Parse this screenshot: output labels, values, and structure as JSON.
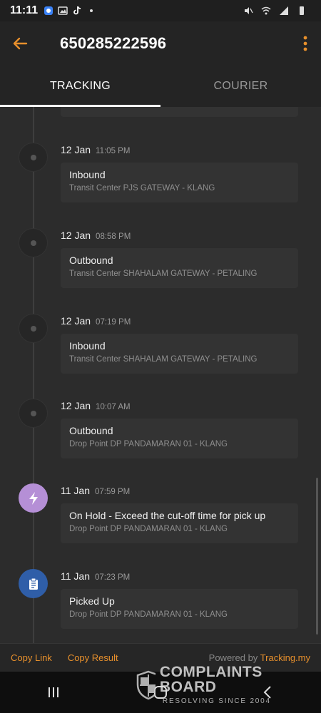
{
  "status_bar": {
    "time": "11:11"
  },
  "header": {
    "title": "650285222596"
  },
  "tabs": [
    {
      "label": "TRACKING",
      "active": true
    },
    {
      "label": "COURIER",
      "active": false
    }
  ],
  "events": [
    {
      "date": "12 Jan",
      "time": "11:05 PM",
      "status": "Inbound",
      "location": "Transit Center PJS GATEWAY - KLANG",
      "icon": "dot"
    },
    {
      "date": "12 Jan",
      "time": "08:58 PM",
      "status": "Outbound",
      "location": "Transit Center SHAHALAM GATEWAY - PETALING",
      "icon": "dot"
    },
    {
      "date": "12 Jan",
      "time": "07:19 PM",
      "status": "Inbound",
      "location": "Transit Center SHAHALAM GATEWAY - PETALING",
      "icon": "dot"
    },
    {
      "date": "12 Jan",
      "time": "10:07 AM",
      "status": "Outbound",
      "location": "Drop Point DP PANDAMARAN 01 - KLANG",
      "icon": "dot"
    },
    {
      "date": "11 Jan",
      "time": "07:59 PM",
      "status": "On Hold - Exceed the cut-off time for pick up",
      "location": "Drop Point DP PANDAMARAN 01 - KLANG",
      "icon": "lightning-icon"
    },
    {
      "date": "11 Jan",
      "time": "07:23 PM",
      "status": "Picked Up",
      "location": "Drop Point DP PANDAMARAN 01 - KLANG",
      "icon": "clipboard-icon"
    }
  ],
  "footer": {
    "copy_link": "Copy Link",
    "copy_result": "Copy Result",
    "powered_by": "Powered by ",
    "powered_link": "Tracking.my"
  },
  "watermark": {
    "line1": "COMPLAINTS",
    "line2": "BOARD",
    "line3": "RESOLVING SINCE 2004"
  },
  "colors": {
    "accent": "#e8902c",
    "hold_icon": "#b58fd6",
    "pickup_icon": "#2f5ea8"
  }
}
